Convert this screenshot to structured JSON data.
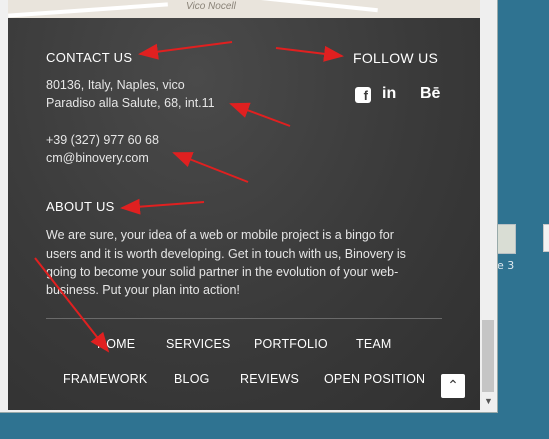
{
  "contact": {
    "heading": "CONTACT US",
    "address_line1": "80136, Italy, Naples, vico",
    "address_line2": "Paradiso alla Salute, 68, int.11",
    "phone": "+39 (327) 977 60 68",
    "email": "cm@binovery.com"
  },
  "follow": {
    "heading": "FOLLOW US",
    "icons": [
      "facebook-icon",
      "linkedin-icon",
      "behance-icon"
    ],
    "linkedin_text": "in",
    "behance_text": "Bē",
    "facebook_text": "f"
  },
  "about": {
    "heading": "ABOUT US",
    "line1": "We are sure, your idea of a web or mobile project is a bingo for",
    "line2": "users and it is worth developing. Get in touch with us, Binovery is",
    "line3": "going to become your solid partner in the evolution of your web-",
    "line4": "business. Put your plan into action!"
  },
  "nav": {
    "row1": [
      "HOME",
      "SERVICES",
      "PORTFOLIO",
      "TEAM"
    ],
    "row2": [
      "FRAMEWORK",
      "BLOG",
      "REVIEWS",
      "OPEN POSITION"
    ]
  },
  "map": {
    "street": "Vico Nocell"
  },
  "scroll_top_icon": "chevron-up-icon",
  "desktop": {
    "label": "e 3"
  },
  "colors": {
    "footer_bg": "#3a3a3a",
    "arrow": "#e02020",
    "desktop_bg": "#2f7391"
  }
}
